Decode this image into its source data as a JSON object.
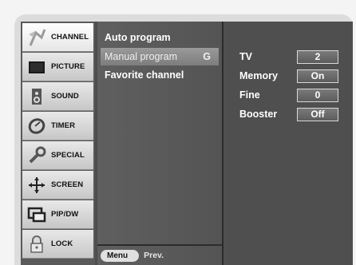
{
  "left_menu": [
    {
      "label": "CHANNEL",
      "icon": "channel-icon",
      "active": true
    },
    {
      "label": "PICTURE",
      "icon": "picture-icon"
    },
    {
      "label": "SOUND",
      "icon": "sound-icon"
    },
    {
      "label": "TIMER",
      "icon": "timer-icon"
    },
    {
      "label": "SPECIAL",
      "icon": "special-icon"
    },
    {
      "label": "SCREEN",
      "icon": "screen-icon"
    },
    {
      "label": "PIP/DW",
      "icon": "pip-icon"
    },
    {
      "label": "LOCK",
      "icon": "lock-icon"
    }
  ],
  "middle_menu": {
    "items": [
      {
        "label": "Auto program"
      },
      {
        "label": "Manual program",
        "selected": true,
        "arrow": "G"
      },
      {
        "label": "Favorite channel"
      }
    ],
    "footer": {
      "menu_button": "Menu",
      "prev_label": "Prev."
    }
  },
  "settings": [
    {
      "label": "TV",
      "value": "2"
    },
    {
      "label": "Memory",
      "value": "On"
    },
    {
      "label": "Fine",
      "value": "0"
    },
    {
      "label": "Booster",
      "value": "Off"
    }
  ]
}
